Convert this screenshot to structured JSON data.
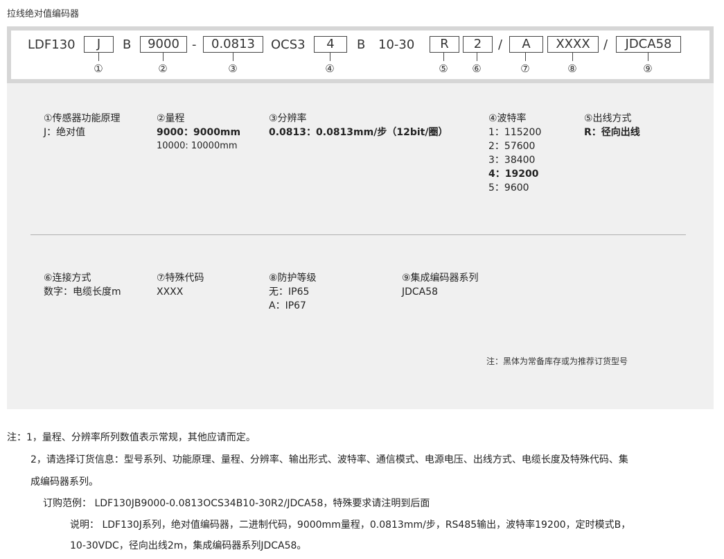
{
  "page_title": "拉线绝对值编码器",
  "model": {
    "prefix": "LDF130",
    "f1": "J",
    "sep_b1": "B",
    "f2": "9000",
    "dash": "-",
    "f3": "0.0813",
    "ocs": "OCS3",
    "f4": "4",
    "sep_b2": "B",
    "voltage": "10-30",
    "f5": "R",
    "f6": "2",
    "slash1": "/",
    "f7": "A",
    "f8": "XXXX",
    "slash2": "/",
    "f9": "JDCA58",
    "marks": [
      "①",
      "②",
      "③",
      "④",
      "⑤",
      "⑥",
      "⑦",
      "⑧",
      "⑨"
    ]
  },
  "blocks": {
    "principle": {
      "title": "①传感器功能原理",
      "lines": [
        "J：绝对值"
      ]
    },
    "range": {
      "title": "②量程",
      "bold_line": "9000：9000mm",
      "line": "10000: 10000mm"
    },
    "resolution": {
      "title": "③分辨率",
      "bold_line": "0.0813：0.0813mm/步（12bit/圈）"
    },
    "baud": {
      "title": "④波特率",
      "l1": "1：115200",
      "l2": "2：57600",
      "l3": "3：38400",
      "l4_bold": "4：19200",
      "l5": "5：9600"
    },
    "outlet": {
      "title": "⑤出线方式",
      "bold_line": "R：径向出线"
    },
    "connection": {
      "title": "⑥连接方式",
      "line": "数字：电缆长度m"
    },
    "special": {
      "title": "⑦特殊代码",
      "line": "XXXX"
    },
    "protection": {
      "title": "⑧防护等级",
      "l1": "无：IP65",
      "l2": "A：IP67"
    },
    "series": {
      "title": "⑨集成编码器系列",
      "line": "JDCA58"
    }
  },
  "panel_note": "注：黑体为常备库存或为推荐订货型号",
  "footnotes": {
    "n1": "注：1，量程、分辨率所列数值表示常规，其他应请而定。",
    "n2a": "2，请选择订货信息：型号系列、功能原理、量程、分辨率、输出形式、波特率、通信模式、电源电压、出线方式、电缆长度及特殊代码、集",
    "n2b": "成编码器系列。",
    "example": "订购范例：  LDF130JB9000-0.0813OCS34B10-30R2/JDCA58，特殊要求请注明到后面",
    "desc_a": "说明：  LDF130J系列，绝对值编码器，二进制代码，9000mm量程，0.0813mm/步，RS485输出，波特率19200，定时模式B，",
    "desc_b": "10-30VDC，径向出线2m，集成编码器系列JDCA58。"
  }
}
